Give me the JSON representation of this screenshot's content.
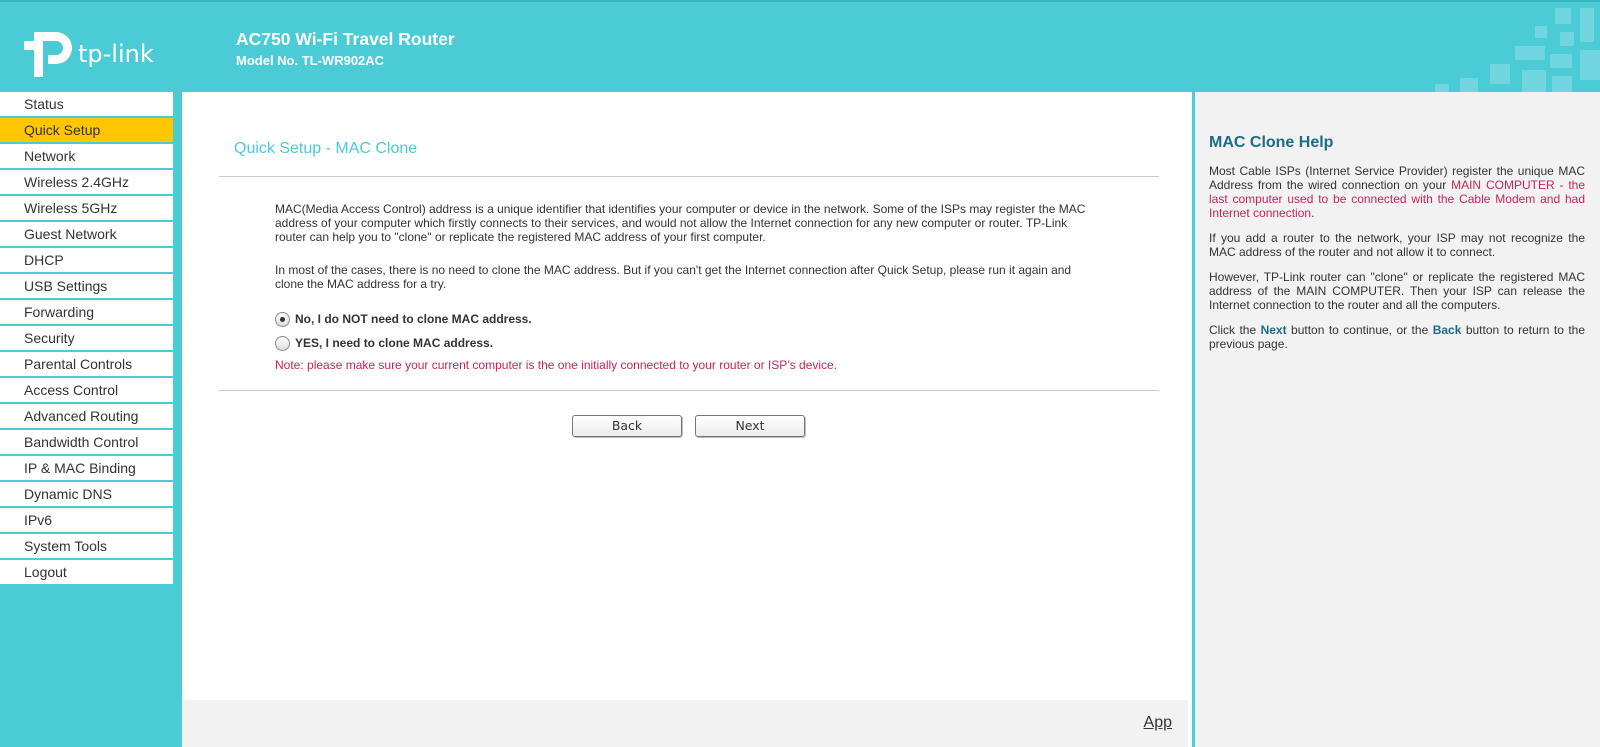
{
  "header": {
    "brand": "tp-link",
    "title": "AC750 Wi-Fi Travel Router",
    "model": "Model No. TL-WR902AC"
  },
  "sidebar": {
    "items": [
      {
        "label": "Status"
      },
      {
        "label": "Quick Setup",
        "active": true
      },
      {
        "label": "Network"
      },
      {
        "label": "Wireless 2.4GHz"
      },
      {
        "label": "Wireless 5GHz"
      },
      {
        "label": "Guest Network"
      },
      {
        "label": "DHCP"
      },
      {
        "label": "USB Settings"
      },
      {
        "label": "Forwarding"
      },
      {
        "label": "Security"
      },
      {
        "label": "Parental Controls"
      },
      {
        "label": "Access Control"
      },
      {
        "label": "Advanced Routing"
      },
      {
        "label": "Bandwidth Control"
      },
      {
        "label": "IP & MAC Binding"
      },
      {
        "label": "Dynamic DNS"
      },
      {
        "label": "IPv6"
      },
      {
        "label": "System Tools"
      },
      {
        "label": "Logout"
      }
    ]
  },
  "main": {
    "title": "Quick Setup - MAC Clone",
    "intro1": "MAC(Media Access Control) address is a unique identifier that identifies your computer or device in the network. Some of the ISPs may register the MAC address of your computer which firstly connects to their services, and would not allow the Internet connection for any new computer or router. TP-Link router can help you to \"clone\" or replicate the registered MAC address of your first computer.",
    "intro2": "In most of the cases, there is no need to clone the MAC address. But if you can't get the Internet connection after Quick Setup, please run it again and clone the MAC address for a try.",
    "option_no": "No, I do NOT need to clone MAC address.",
    "option_yes": "YES, I need to clone MAC address.",
    "selected_option": "no",
    "note": "Note: please make sure your current computer is the one initially connected to your router or ISP’s device.",
    "back_label": "Back",
    "next_label": "Next",
    "footer_link": "App"
  },
  "help": {
    "title": "MAC Clone Help",
    "p1_a": "Most Cable ISPs (Internet Service Provider) register the unique MAC Address from the wired connection on your ",
    "p1_b": "MAIN COMPUTER - the last computer used to be connected with the Cable Modem and had Internet connection",
    "p1_c": ".",
    "p2": "If you add a router to the network, your ISP may not recognize the MAC address of the router and not allow it to connect.",
    "p3": "However, TP-Link router can \"clone\" or replicate the registered MAC address of the MAIN COMPUTER. Then your ISP can release the Internet connection to the router and all the computers.",
    "p4_a": "Click the ",
    "p4_next": "Next",
    "p4_b": " button to continue, or the ",
    "p4_back": "Back",
    "p4_c": " button to return to the previous page."
  },
  "colors": {
    "brand_teal": "#4acbd6",
    "active_nav": "#ffc600",
    "note_pink": "#c8245b",
    "help_title": "#1e6b87"
  }
}
